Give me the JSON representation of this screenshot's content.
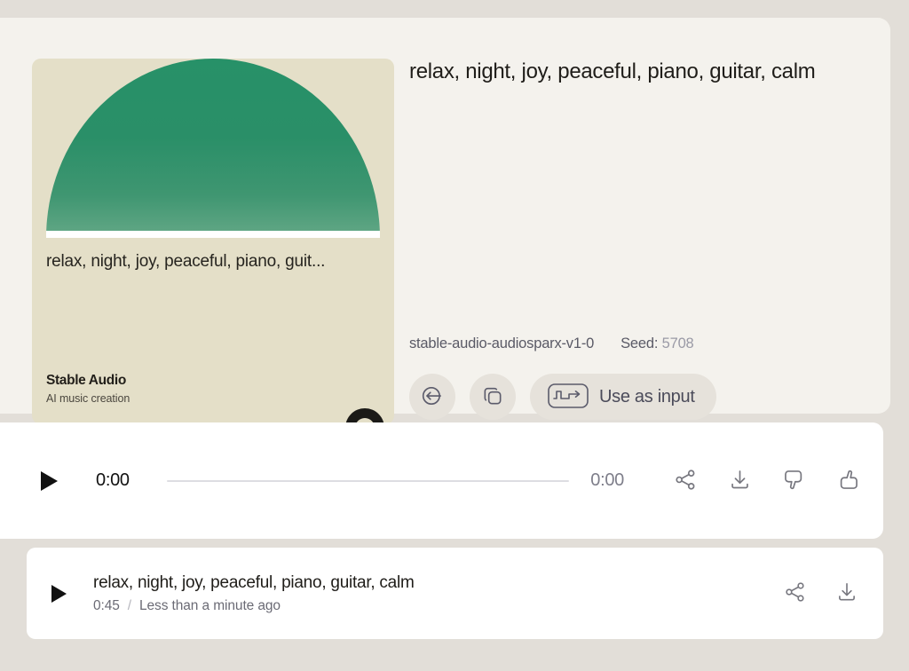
{
  "colors": {
    "page_background": "#e2ded8",
    "panel_background": "#f4f2ed",
    "art_card_background": "#e4dfc8",
    "artwork_green_top": "#279168",
    "artwork_green_bottom": "#a6c5ac",
    "button_background": "#e6e2db",
    "row_background": "#ffffff",
    "text_primary": "#1f1d19",
    "text_muted": "#6b6b75",
    "seed_value": "#9a9aa6"
  },
  "artwork": {
    "caption": "relax, night, joy, peaceful, piano, guit...",
    "brand_name": "Stable Audio",
    "brand_tagline": "AI music creation",
    "brand_mark_icon": "stability-arch-logo"
  },
  "info": {
    "prompt": "relax, night, joy, peaceful, piano, guitar, calm",
    "model": "stable-audio-audiosparx-v1-0",
    "seed_label": "Seed:",
    "seed_value": "5708"
  },
  "actions": [
    {
      "name": "restore-prompt",
      "label": "",
      "icon": "arrow-left-in-circle-icon"
    },
    {
      "name": "copy",
      "label": "",
      "icon": "copy-icon"
    },
    {
      "name": "use-as-input",
      "label": "Use as input",
      "icon": "waveform-arrow-icon"
    }
  ],
  "player": {
    "play_icon": "play-icon",
    "current_time": "0:00",
    "duration": "0:00",
    "progress_percent": 0,
    "icons": [
      {
        "name": "share",
        "icon": "share-icon"
      },
      {
        "name": "download",
        "icon": "download-icon"
      },
      {
        "name": "thumbs-down",
        "icon": "thumbs-down-icon"
      },
      {
        "name": "thumbs-up",
        "icon": "thumbs-up-icon"
      }
    ]
  },
  "track_row": {
    "play_icon": "play-icon",
    "title": "relax, night, joy, peaceful, piano, guitar, calm",
    "duration": "0:45",
    "separator": "/",
    "timestamp": "Less than a minute ago",
    "icons": [
      {
        "name": "share",
        "icon": "share-icon"
      },
      {
        "name": "download",
        "icon": "download-icon"
      }
    ]
  }
}
